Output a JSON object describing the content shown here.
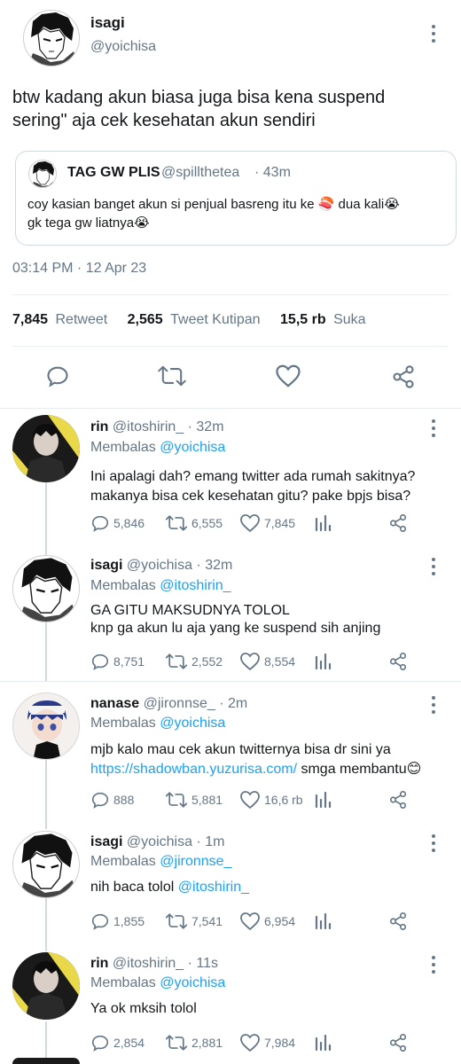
{
  "main_tweet": {
    "name": "isagi",
    "handle": "@yoichisa",
    "text_line1": "btw kadang akun biasa juga bisa kena suspend",
    "text_line2": "sering\" aja cek kesehatan akun sendiri",
    "quote": {
      "name": "TAG GW PLIS",
      "handle": "@spillthetea",
      "time": "· 43m",
      "line1": "coy kasian banget akun si penjual basreng itu ke 🍣 dua kali😭",
      "line2": "gk tega gw liatnya😭"
    },
    "timestamp": "03:14 PM · 12 Apr 23",
    "stats": {
      "retweets_count": "7,845",
      "retweets_label": "Retweet",
      "quotes_count": "2,565",
      "quotes_label": "Tweet Kutipan",
      "likes_count": "15,5 rb",
      "likes_label": "Suka"
    }
  },
  "replies": [
    {
      "name": "rin",
      "handle": "@itoshirin_ · 32m",
      "replying_label": "Membalas",
      "replying_to": "@yoichisa",
      "line1": "Ini apalagi dah? emang twitter ada rumah sakitnya?",
      "line2": "makanya bisa cek kesehatan gitu? pake bpjs bisa?",
      "replies": "5,846",
      "retweets": "6,555",
      "likes": "7,845"
    },
    {
      "name": "isagi",
      "handle": "@yoichisa · 32m",
      "replying_label": "Membalas",
      "replying_to": "@itoshirin_",
      "line1": "GA GITU MAKSUDNYA TOLOL",
      "line2": "knp ga akun lu aja yang ke suspend sih anjing",
      "replies": "8,751",
      "retweets": "2,552",
      "likes": "8,554"
    },
    {
      "name": "nanase",
      "handle": "@jironnse_ · 2m",
      "replying_label": "Membalas",
      "replying_to": "@yoichisa",
      "line1": "mjb kalo mau cek akun twitternya bisa dr sini ya",
      "line2_link": "https://shadowban.yuzurisa.com/",
      "line2_rest": " smga membantu😊",
      "replies": "888",
      "retweets": "5,881",
      "likes": "16,6 rb"
    },
    {
      "name": "isagi",
      "handle": "@yoichisa · 1m",
      "replying_label": "Membalas",
      "replying_to": "@jironnse_",
      "line1_text": "nih baca tolol ",
      "line1_mention": "@itoshirin_",
      "replies": "1,855",
      "retweets": "7,541",
      "likes": "6,954"
    },
    {
      "name": "rin",
      "handle": "@itoshirin_ · 11s",
      "replying_label": "Membalas",
      "replying_to": "@yoichisa",
      "line1": "Ya ok mksih tolol",
      "replies": "2,854",
      "retweets": "2,881",
      "likes": "7,984"
    }
  ]
}
